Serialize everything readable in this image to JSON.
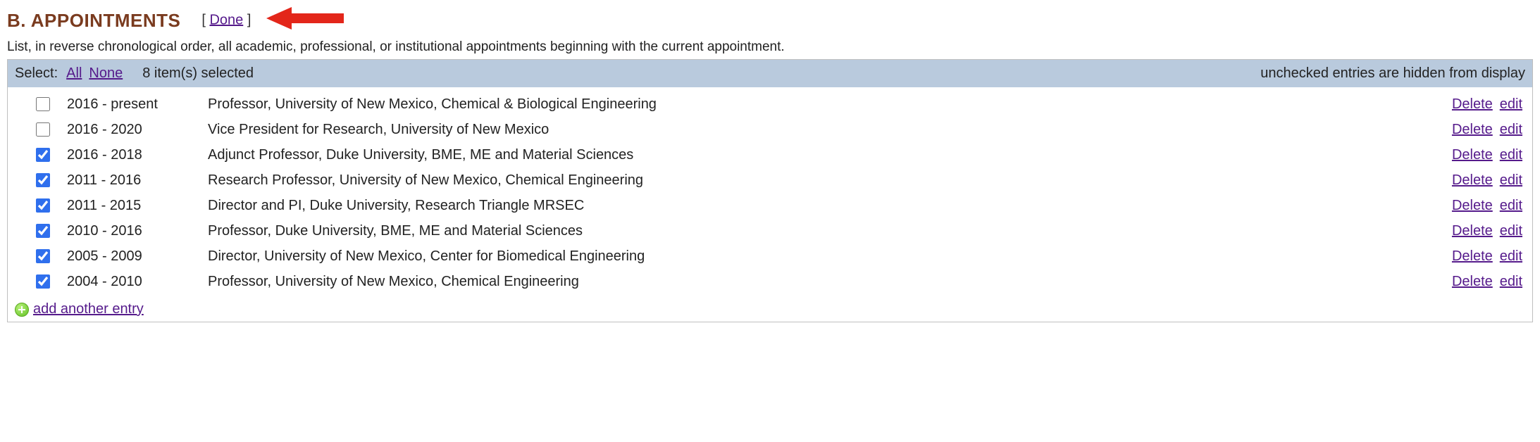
{
  "header": {
    "section_title": "B. APPOINTMENTS",
    "done_label": "Done"
  },
  "instructions": "List, in reverse chronological order, all academic, professional, or institutional appointments beginning with the current appointment.",
  "select_bar": {
    "select_label": "Select:",
    "all_label": "All",
    "none_label": "None",
    "count_text": "8 item(s) selected",
    "right_notice": "unchecked entries are hidden from display"
  },
  "actions": {
    "delete_label": "Delete",
    "edit_label": "edit"
  },
  "rows": [
    {
      "checked": false,
      "dates": "2016 - present",
      "desc": "Professor, University of New Mexico, Chemical & Biological Engineering"
    },
    {
      "checked": false,
      "dates": "2016 - 2020",
      "desc": "Vice President for Research, University of New Mexico"
    },
    {
      "checked": true,
      "dates": "2016 - 2018",
      "desc": "Adjunct Professor, Duke University, BME, ME and Material Sciences"
    },
    {
      "checked": true,
      "dates": "2011 - 2016",
      "desc": "Research Professor, University of New Mexico, Chemical Engineering"
    },
    {
      "checked": true,
      "dates": "2011 - 2015",
      "desc": "Director and PI, Duke University, Research Triangle MRSEC"
    },
    {
      "checked": true,
      "dates": "2010 - 2016",
      "desc": "Professor, Duke University, BME, ME and Material Sciences"
    },
    {
      "checked": true,
      "dates": "2005 - 2009",
      "desc": "Director, University of New Mexico, Center for Biomedical Engineering"
    },
    {
      "checked": true,
      "dates": "2004 - 2010",
      "desc": "Professor, University of New Mexico, Chemical Engineering"
    }
  ],
  "add_label": "add another entry"
}
